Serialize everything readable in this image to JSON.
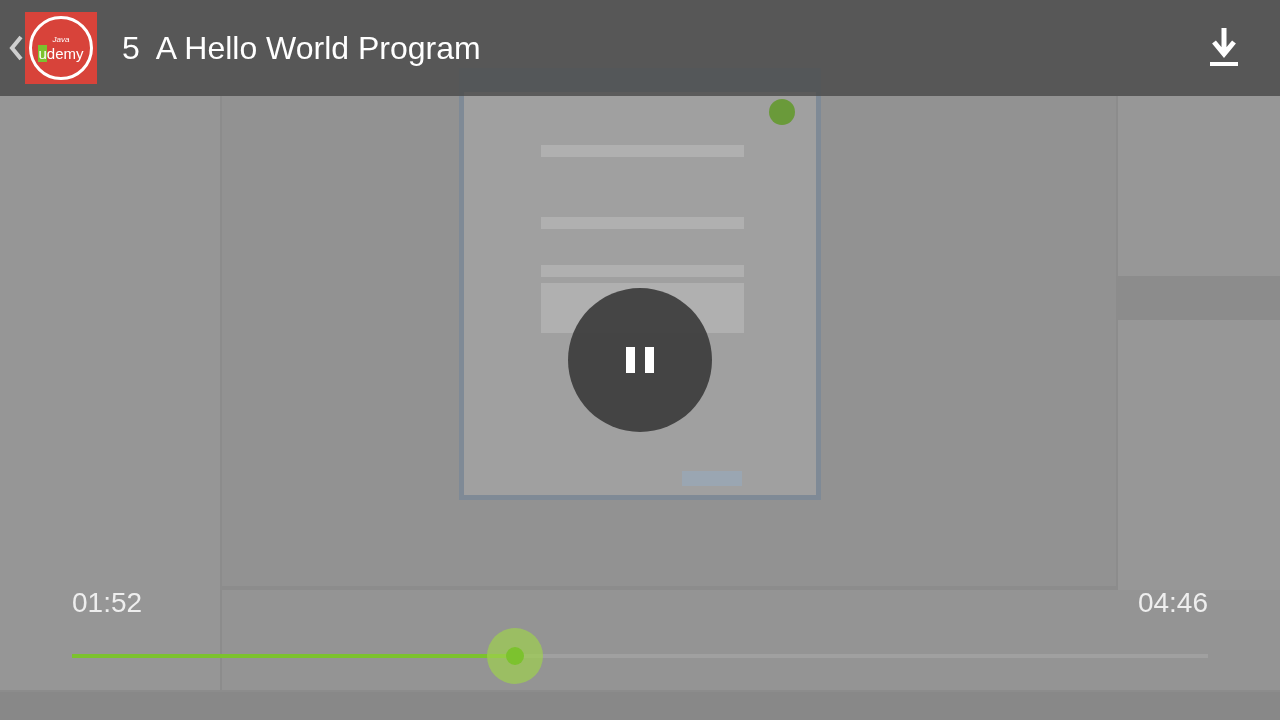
{
  "header": {
    "logo": {
      "caption": "Java",
      "wordmark": "udemy"
    },
    "title": "5  A Hello World Program"
  },
  "player": {
    "playing": true,
    "elapsed": "01:52",
    "duration": "04:46",
    "level": 0.39
  }
}
